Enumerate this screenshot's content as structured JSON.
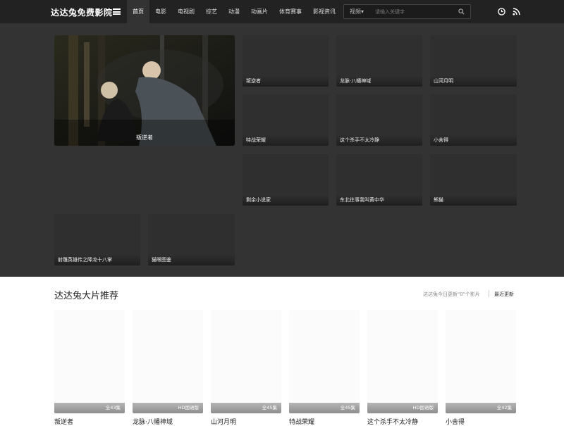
{
  "header": {
    "logo": "达达兔免费影院",
    "nav": [
      "首页",
      "电影",
      "电视剧",
      "综艺",
      "动漫",
      "动画片",
      "体育赛事",
      "影视资讯"
    ],
    "search": {
      "type": "视频▾",
      "placeholder": "请输入关键字"
    }
  },
  "hero": {
    "feature": {
      "title": "叛逆者"
    },
    "cards": [
      "叛逆者",
      "龙脉·八幡神域",
      "山河月明",
      "特战荣耀",
      "这个杀手不太冷静",
      "小舍得",
      "剩余小说家",
      "东北往事我叫黄中华",
      "熊猫",
      "射雕英雄传之降龙十八掌",
      "猫眼图鉴"
    ]
  },
  "recommend": {
    "title": "达达兔大片推荐",
    "update_text": "达达兔今日更新\"0\"个影片",
    "latest_link": "最近更新",
    "items": [
      {
        "title": "叛逆者",
        "badge": "全43集"
      },
      {
        "title": "龙脉·八幡神域",
        "badge": "HD国语版"
      },
      {
        "title": "山河月明",
        "badge": "全45集"
      },
      {
        "title": "特战荣耀",
        "badge": "全45集"
      },
      {
        "title": "这个杀手不太冷静",
        "badge": "HD国语版"
      },
      {
        "title": "小舍得",
        "badge": "全42集"
      }
    ]
  }
}
